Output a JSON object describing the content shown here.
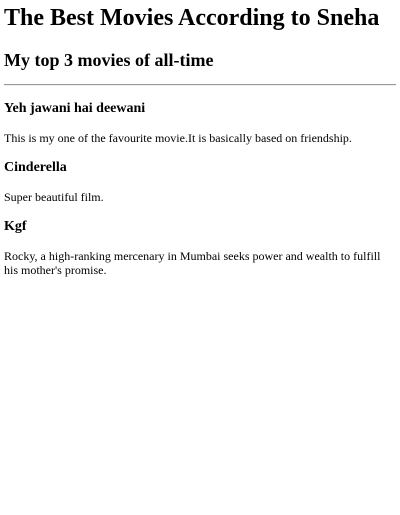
{
  "page": {
    "title": "The Best Movies According to Sneha",
    "subtitle": "My top 3 movies of all-time"
  },
  "movies": [
    {
      "name": "Yeh jawani hai deewani",
      "description": "This is my one of the favourite movie.It is basically based on friendship."
    },
    {
      "name": "Cinderella",
      "description": "Super beautiful film."
    },
    {
      "name": "Kgf",
      "description": "Rocky, a high-ranking mercenary in Mumbai seeks power and wealth to fulfill his mother's promise."
    }
  ]
}
